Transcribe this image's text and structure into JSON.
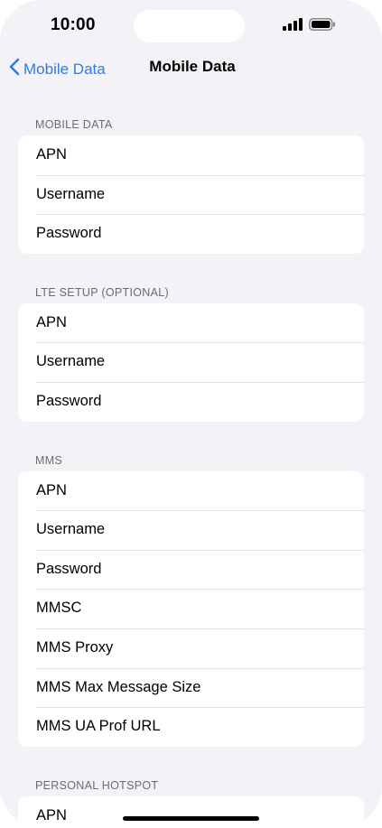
{
  "status_bar": {
    "time": "10:00"
  },
  "nav": {
    "back_label": "Mobile Data",
    "title": "Mobile Data"
  },
  "sections": [
    {
      "header": "MOBILE DATA",
      "rows": [
        "APN",
        "Username",
        "Password"
      ]
    },
    {
      "header": "LTE SETUP (OPTIONAL)",
      "rows": [
        "APN",
        "Username",
        "Password"
      ]
    },
    {
      "header": "MMS",
      "rows": [
        "APN",
        "Username",
        "Password",
        "MMSC",
        "MMS Proxy",
        "MMS Max Message Size",
        "MMS UA Prof URL"
      ]
    },
    {
      "header": "PERSONAL HOTSPOT",
      "rows": [
        "APN"
      ]
    }
  ],
  "colors": {
    "accent": "#2f7de1",
    "background": "#f2f2f7",
    "card": "#ffffff"
  }
}
